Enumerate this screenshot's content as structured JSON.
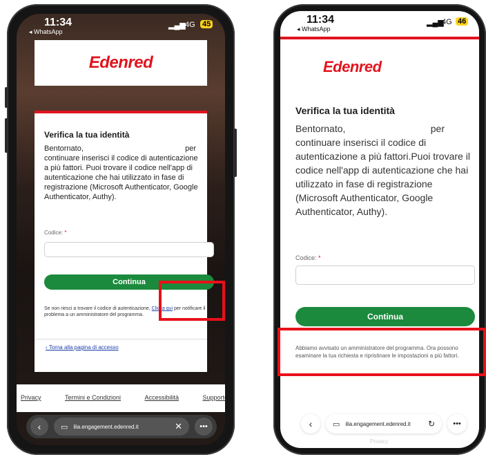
{
  "left": {
    "status": {
      "time": "11:34",
      "back": "◂ WhatsApp",
      "signal": "4G",
      "battery": "45"
    },
    "logo": "Edenred",
    "title": "Verifica la tua identità",
    "intro_a": "Bentornato,",
    "intro_b": "per",
    "intro_rest": "continuare inserisci il codice di autenticazione a più fattori. Puoi trovare il codice nell'app di autenticazione che hai utilizzato in fase di registrazione (Microsoft Authenticator, Google Authenticator, Authy).",
    "code_label": "Codice:",
    "code_required": "*",
    "continue": "Continua",
    "help_text": "Se non riesci a trovare il codice di autenticazione,",
    "help_link": "Clicca qui",
    "help_text2": "per notificare il problema a un amministratore del programma.",
    "back_link": "‹ Torna alla pagina di accesso",
    "footer": [
      "Privacy",
      "Termini e Condizioni",
      "Accessibilità",
      "Supporto"
    ],
    "url": "ilia.engagement.edenred.it"
  },
  "right": {
    "status": {
      "time": "11:34",
      "back": "◂ WhatsApp",
      "signal": "4G",
      "battery": "46"
    },
    "logo": "Edenred",
    "title": "Verifica la tua identità",
    "intro_a": "Bentornato,",
    "intro_b": "per",
    "intro_rest": "continuare inserisci il codice di autenticazione a più fattori.Puoi trovare il codice nell'app di autenticazione che hai utilizzato in fase di registrazione (Microsoft Authenticator, Google Authenticator, Authy).",
    "code_label": "Codice:",
    "code_required": "*",
    "continue": "Continua",
    "notice": "Abbiamo avvisato un amministratore del programma. Ora possono esaminare la tua richiesta e ripristinare le impostazioni a più fattori.",
    "url": "ilia.engagement.edenred.it",
    "footer_hint": "Privacy"
  },
  "colors": {
    "brand_red": "#e1141e",
    "cta_green": "#1b8a3c",
    "highlight": "#e8101a"
  }
}
